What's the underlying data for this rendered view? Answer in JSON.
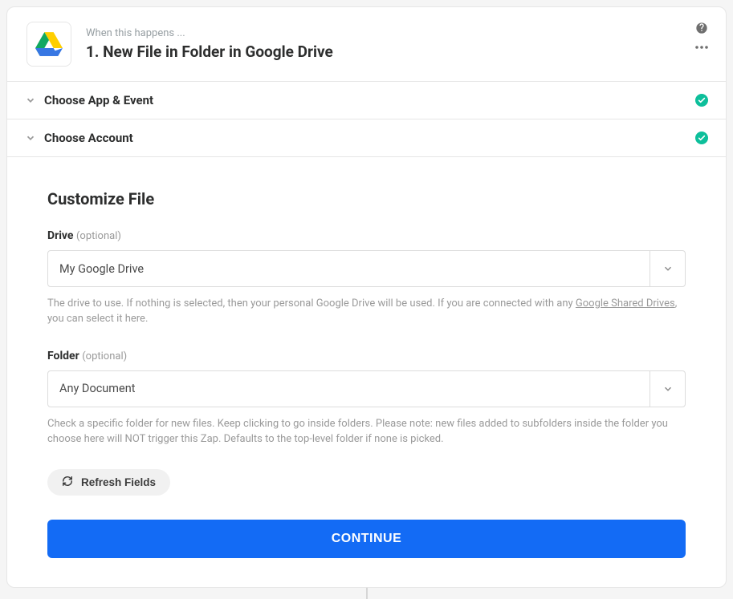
{
  "header": {
    "eyebrow": "When this happens ...",
    "title": "1. New File in Folder in Google Drive"
  },
  "sections": {
    "choose_app": "Choose App & Event",
    "choose_account": "Choose Account"
  },
  "body": {
    "title": "Customize File",
    "drive": {
      "label": "Drive",
      "optional": "(optional)",
      "value": "My Google Drive",
      "help_pre": "The drive to use. If nothing is selected, then your personal Google Drive will be used. If you are connected with any ",
      "help_link": "Google Shared Drives",
      "help_post": ", you can select it here."
    },
    "folder": {
      "label": "Folder",
      "optional": "(optional)",
      "value": "Any Document",
      "help": "Check a specific folder for new files. Keep clicking to go inside folders. Please note: new files added to subfolders inside the folder you choose here will NOT trigger this Zap. Defaults to the top-level folder if none is picked."
    },
    "refresh_label": "Refresh Fields",
    "continue_label": "CONTINUE"
  }
}
